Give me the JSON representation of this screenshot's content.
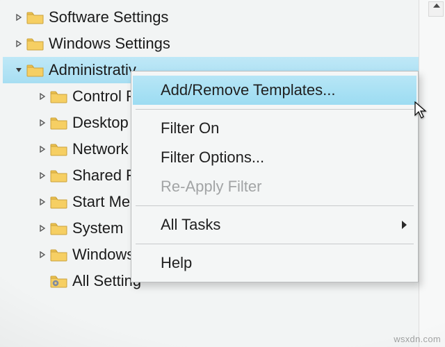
{
  "tree": {
    "top_partial": "",
    "items": [
      {
        "label": "Software Settings",
        "indent": 1,
        "caret": "right",
        "icon": "folder",
        "selected": false
      },
      {
        "label": "Windows Settings",
        "indent": 1,
        "caret": "right",
        "icon": "folder",
        "selected": false
      },
      {
        "label": "Administrativ",
        "indent": 1,
        "caret": "down",
        "icon": "folder",
        "selected": true
      },
      {
        "label": "Control P",
        "indent": 2,
        "caret": "right",
        "icon": "folder",
        "selected": false
      },
      {
        "label": "Desktop",
        "indent": 2,
        "caret": "right",
        "icon": "folder",
        "selected": false
      },
      {
        "label": "Network",
        "indent": 2,
        "caret": "right",
        "icon": "folder",
        "selected": false
      },
      {
        "label": "Shared Fo",
        "indent": 2,
        "caret": "right",
        "icon": "folder",
        "selected": false
      },
      {
        "label": "Start Mer",
        "indent": 2,
        "caret": "right",
        "icon": "folder",
        "selected": false
      },
      {
        "label": "System",
        "indent": 2,
        "caret": "right",
        "icon": "folder",
        "selected": false
      },
      {
        "label": "Windows",
        "indent": 2,
        "caret": "right",
        "icon": "folder",
        "selected": false
      },
      {
        "label": "All Setting",
        "indent": 2,
        "caret": "",
        "icon": "settings-folder",
        "selected": false
      }
    ]
  },
  "context_menu": {
    "items": [
      {
        "label": "Add/Remove Templates...",
        "enabled": true,
        "highlighted": true,
        "submenu": false
      },
      {
        "label": "Filter On",
        "enabled": true,
        "highlighted": false,
        "submenu": false
      },
      {
        "label": "Filter Options...",
        "enabled": true,
        "highlighted": false,
        "submenu": false
      },
      {
        "label": "Re-Apply Filter",
        "enabled": false,
        "highlighted": false,
        "submenu": false
      },
      {
        "label": "All Tasks",
        "enabled": true,
        "highlighted": false,
        "submenu": true
      },
      {
        "label": "Help",
        "enabled": true,
        "highlighted": false,
        "submenu": false
      }
    ]
  },
  "watermark": "wsxdn.com"
}
